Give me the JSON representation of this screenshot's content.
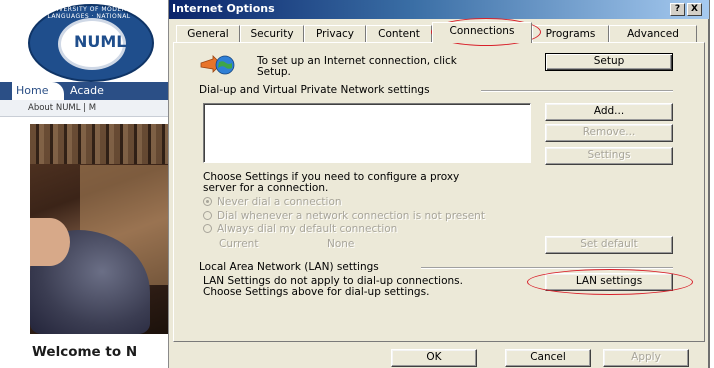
{
  "site": {
    "logo_text": "UNIVERSITY OF MODERN LANGUAGES · NATIONAL",
    "logo_mark": "NUML",
    "nav": [
      "Home",
      "Acade"
    ],
    "subnav": "About NUML  |  M",
    "welcome": "Welcome to N"
  },
  "dialog": {
    "title": "Internet Options",
    "title_buttons": [
      "?",
      "X"
    ],
    "tabs": [
      "General",
      "Security",
      "Privacy",
      "Content",
      "Connections",
      "Programs",
      "Advanced"
    ],
    "active_tab": "Connections",
    "setup": {
      "text_line1": "To set up an Internet connection, click",
      "text_line2": "Setup.",
      "button": "Setup"
    },
    "dialup": {
      "heading": "Dial-up and Virtual Private Network settings",
      "add_button": "Add...",
      "remove_button": "Remove...",
      "settings_button": "Settings",
      "choose_line1": "Choose Settings if you need to configure a proxy",
      "choose_line2": "server for a connection.",
      "radio_never": "Never dial a connection",
      "radio_whenever": "Dial whenever a network connection is not present",
      "radio_always": "Always dial my default connection",
      "current_label": "Current",
      "current_value": "None",
      "set_default_button": "Set default"
    },
    "lan": {
      "heading": "Local Area Network (LAN) settings",
      "text_line1": "LAN Settings do not apply to dial-up connections.",
      "text_line2": "Choose Settings above for dial-up settings.",
      "button": "LAN settings"
    },
    "footer": {
      "ok": "OK",
      "cancel": "Cancel",
      "apply": "Apply"
    },
    "colors": {
      "dialog_bg": "#ece9d8",
      "titlebar_start": "#0a246a",
      "titlebar_end": "#a6caf0",
      "annotation": "#d8202a"
    }
  }
}
